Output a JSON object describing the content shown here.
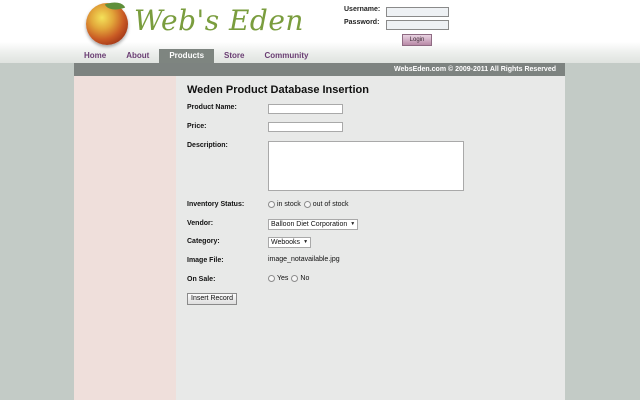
{
  "logo": {
    "text": "Web's Eden"
  },
  "login": {
    "username_label": "Username:",
    "password_label": "Password:",
    "username_value": "",
    "password_value": "",
    "button_label": "Login"
  },
  "nav": {
    "items": [
      {
        "label": "Home",
        "active": false
      },
      {
        "label": "About",
        "active": false
      },
      {
        "label": "Products",
        "active": true
      },
      {
        "label": "Store",
        "active": false
      },
      {
        "label": "Community",
        "active": false
      }
    ]
  },
  "bar": {
    "copyright": "WebsEden.com © 2009-2011 All Rights Reserved"
  },
  "form": {
    "title": "Weden Product Database Insertion",
    "product_name": {
      "label": "Product Name:",
      "value": ""
    },
    "price": {
      "label": "Price:",
      "value": ""
    },
    "description": {
      "label": "Description:",
      "value": ""
    },
    "inventory_status": {
      "label": "Inventory Status:",
      "options": [
        "in stock",
        "out of stock"
      ]
    },
    "vendor": {
      "label": "Vendor:",
      "selected": "Balloon Diet Corporation"
    },
    "category": {
      "label": "Category:",
      "selected": "Webooks"
    },
    "image_file": {
      "label": "Image File:",
      "value": "image_notavailable.jpg"
    },
    "on_sale": {
      "label": "On Sale:",
      "options": [
        "Yes",
        "No"
      ]
    },
    "submit_label": "Insert Record"
  },
  "colors": {
    "page_bg": "#c3cbc6",
    "left_col": "#efdfdb",
    "main_col": "#e8e9e8",
    "bar": "#7d8380",
    "nav_text": "#6a3d73",
    "logo_green": "#7a9d3e"
  }
}
